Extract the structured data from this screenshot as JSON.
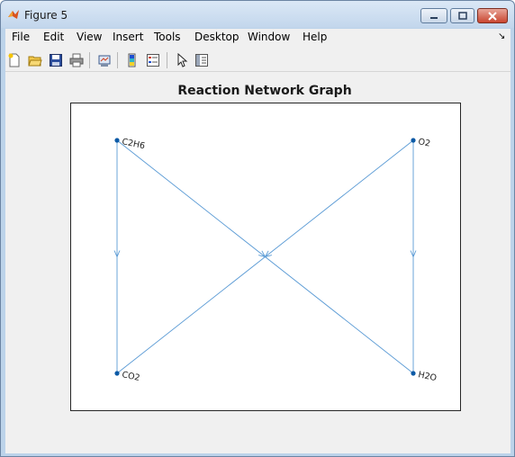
{
  "window": {
    "title": "Figure 5"
  },
  "menu": {
    "items": [
      "File",
      "Edit",
      "View",
      "Insert",
      "Tools",
      "Desktop",
      "Window",
      "Help"
    ]
  },
  "toolbar": {
    "buttons": [
      "new-figure-icon",
      "open-file-icon",
      "save-icon",
      "print-icon",
      "link-plot-icon",
      "colorbar-icon",
      "legend-icon",
      "pointer-icon",
      "property-inspector-icon"
    ]
  },
  "plot": {
    "title": "Reaction Network Graph",
    "nodes": [
      {
        "id": "C2H6",
        "label": "C2H6"
      },
      {
        "id": "O2",
        "label": "O2"
      },
      {
        "id": "CO2",
        "label": "CO2"
      },
      {
        "id": "H2O",
        "label": "H2O"
      }
    ],
    "edges": [
      {
        "from": "C2H6",
        "to": "CO2"
      },
      {
        "from": "C2H6",
        "to": "H2O"
      },
      {
        "from": "O2",
        "to": "CO2"
      },
      {
        "from": "O2",
        "to": "H2O"
      }
    ],
    "colors": {
      "edge": "#5b9bd5",
      "node": "#0b5aa6"
    }
  }
}
